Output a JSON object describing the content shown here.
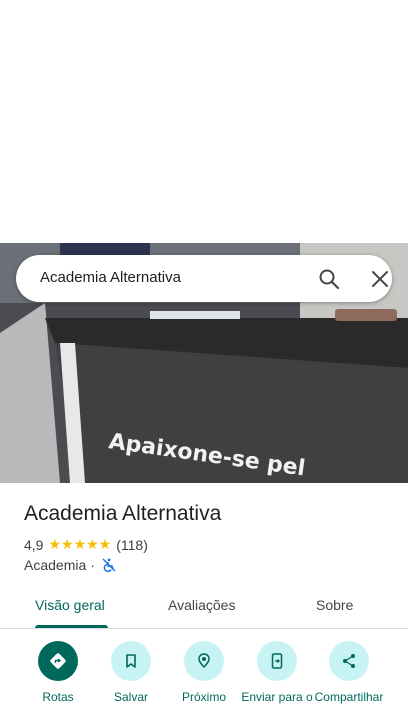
{
  "search": {
    "value": "Academia Alternativa"
  },
  "photo": {
    "sign_text": "Apaixone-se pel"
  },
  "place": {
    "name": "Academia Alternativa",
    "rating": "4,9",
    "stars": "★★★★★",
    "reviews": "(118)",
    "category": "Academia",
    "separator": "·"
  },
  "tabs": [
    {
      "label": "Visão geral",
      "active": true
    },
    {
      "label": "Avaliações",
      "active": false
    },
    {
      "label": "Sobre",
      "active": false
    }
  ],
  "actions": [
    {
      "label": "Rotas",
      "icon": "directions-icon"
    },
    {
      "label": "Salvar",
      "icon": "bookmark-icon"
    },
    {
      "label": "Próximo",
      "icon": "nearby-icon"
    },
    {
      "label": "Enviar para o",
      "icon": "send-to-phone-icon"
    },
    {
      "label": "Compartilhar",
      "icon": "share-icon"
    }
  ],
  "colors": {
    "accent": "#00695c",
    "chip": "#c7f3f5",
    "star": "#fbbc04"
  }
}
